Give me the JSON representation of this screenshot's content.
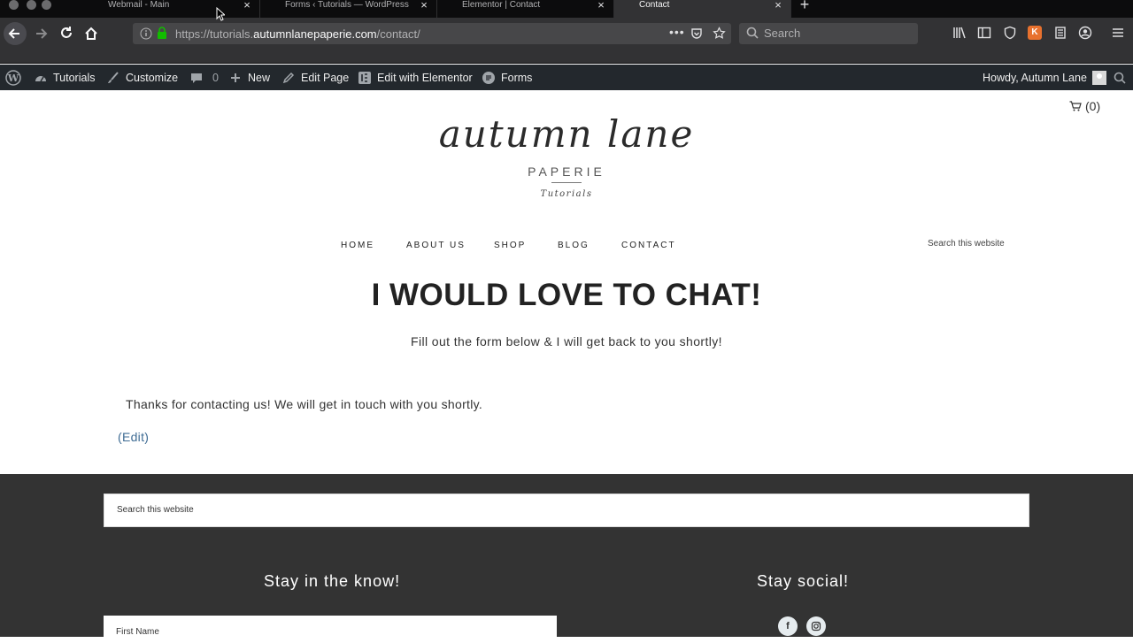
{
  "browser": {
    "tabs": [
      {
        "title": "Webmail - Main",
        "active": false
      },
      {
        "title": "Forms ‹ Tutorials — WordPress",
        "active": false
      },
      {
        "title": "Elementor | Contact",
        "active": false
      },
      {
        "title": "Contact",
        "active": true
      }
    ],
    "url": {
      "scheme_sub": "https://tutorials.",
      "host": "autumnlanepaperie.com",
      "path": "/contact/"
    },
    "search_placeholder": "Search"
  },
  "admin_bar": {
    "site": "Tutorials",
    "customize": "Customize",
    "comments_count": "0",
    "new": "New",
    "edit_page": "Edit Page",
    "edit_elementor": "Edit with Elementor",
    "forms": "Forms",
    "howdy": "Howdy, Autumn Lane"
  },
  "site": {
    "cart": "(0)",
    "logo_script": "autumn lane",
    "logo_word": "PAPERIE",
    "logo_sub": "Tutorials",
    "nav": [
      "HOME",
      "ABOUT US",
      "SHOP",
      "BLOG",
      "CONTACT"
    ],
    "search_placeholder": "Search this website"
  },
  "content": {
    "headline": "I WOULD LOVE TO CHAT!",
    "subline": "Fill out the form below & I will get back to you shortly!",
    "thanks": "Thanks for contacting us! We will get in touch with you shortly.",
    "edit": "(Edit)"
  },
  "footer": {
    "search_placeholder": "Search this website",
    "newsletter_heading": "Stay in the know!",
    "social_heading": "Stay social!",
    "first_name_placeholder": "First Name",
    "social_icons": [
      "facebook-icon",
      "instagram-icon"
    ]
  },
  "colors": {
    "admin_bar": "#23282d",
    "footer": "#333333",
    "link": "#3f6c94",
    "secure_lock": "#12bc00"
  }
}
